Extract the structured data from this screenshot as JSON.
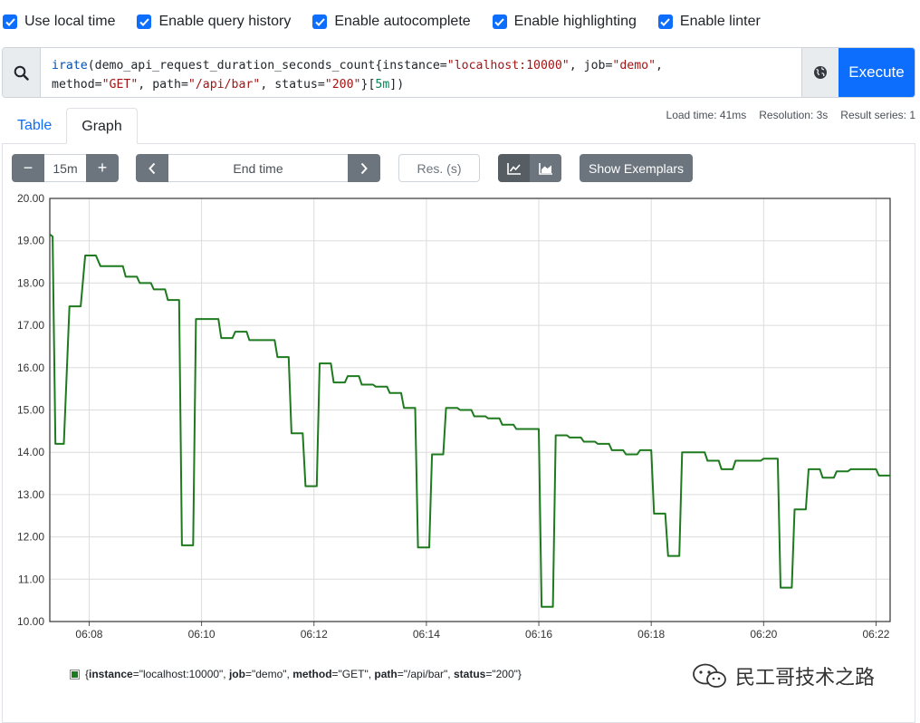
{
  "options": [
    {
      "label": "Use local time",
      "checked": true
    },
    {
      "label": "Enable query history",
      "checked": true
    },
    {
      "label": "Enable autocomplete",
      "checked": true
    },
    {
      "label": "Enable highlighting",
      "checked": true
    },
    {
      "label": "Enable linter",
      "checked": true
    }
  ],
  "query": {
    "fn": "irate",
    "metric": "demo_api_request_duration_seconds_count",
    "labels": [
      {
        "name": "instance",
        "value": "\"localhost:10000\""
      },
      {
        "name": "job",
        "value": "\"demo\""
      },
      {
        "name": "method",
        "value": "\"GET\""
      },
      {
        "name": "path",
        "value": "\"/api/bar\""
      },
      {
        "name": "status",
        "value": "\"200\""
      }
    ],
    "range": "5m"
  },
  "execute_label": "Execute",
  "tabs": {
    "table": "Table",
    "graph": "Graph"
  },
  "stats": {
    "load_time": "Load time: 41ms",
    "resolution": "Resolution: 3s",
    "result_series": "Result series: 1"
  },
  "controls": {
    "minus": "−",
    "range": "15m",
    "plus": "+",
    "end_time_placeholder": "End time",
    "res_placeholder": "Res. (s)",
    "show_exemplars": "Show Exemplars"
  },
  "legend": {
    "parts": [
      {
        "text": "{",
        "bold": false
      },
      {
        "text": "instance",
        "bold": true
      },
      {
        "text": "=\"localhost:10000\", ",
        "bold": false
      },
      {
        "text": "job",
        "bold": true
      },
      {
        "text": "=\"demo\", ",
        "bold": false
      },
      {
        "text": "method",
        "bold": true
      },
      {
        "text": "=\"GET\", ",
        "bold": false
      },
      {
        "text": "path",
        "bold": true
      },
      {
        "text": "=\"/api/bar\", ",
        "bold": false
      },
      {
        "text": "status",
        "bold": true
      },
      {
        "text": "=\"200\"}",
        "bold": false
      }
    ]
  },
  "watermark": "民工哥技术之路",
  "colors": {
    "series": "#1e7a1e",
    "accent": "#0d6efd",
    "secondary": "#6c757d"
  },
  "chart_data": {
    "type": "line",
    "ylim": [
      10,
      20
    ],
    "yticks": [
      "10.00",
      "11.00",
      "12.00",
      "13.00",
      "14.00",
      "15.00",
      "16.00",
      "17.00",
      "18.00",
      "19.00",
      "20.00"
    ],
    "xlim_min": [
      7.3,
      22.25
    ],
    "xticks": [
      {
        "label": "06:08",
        "min": 8
      },
      {
        "label": "06:10",
        "min": 10
      },
      {
        "label": "06:12",
        "min": 12
      },
      {
        "label": "06:14",
        "min": 14
      },
      {
        "label": "06:16",
        "min": 16
      },
      {
        "label": "06:18",
        "min": 18
      },
      {
        "label": "06:20",
        "min": 20
      },
      {
        "label": "06:22",
        "min": 22
      }
    ],
    "series": [
      {
        "values": [
          [
            7.3,
            19.15
          ],
          [
            7.35,
            19.1
          ],
          [
            7.4,
            14.2
          ],
          [
            7.55,
            14.2
          ],
          [
            7.65,
            17.45
          ],
          [
            7.85,
            17.45
          ],
          [
            7.93,
            18.65
          ],
          [
            8.12,
            18.65
          ],
          [
            8.2,
            18.4
          ],
          [
            8.6,
            18.4
          ],
          [
            8.65,
            18.15
          ],
          [
            8.85,
            18.15
          ],
          [
            8.9,
            18.0
          ],
          [
            9.1,
            18.0
          ],
          [
            9.15,
            17.85
          ],
          [
            9.35,
            17.85
          ],
          [
            9.4,
            17.6
          ],
          [
            9.6,
            17.6
          ],
          [
            9.65,
            11.8
          ],
          [
            9.85,
            11.8
          ],
          [
            9.9,
            17.15
          ],
          [
            10.3,
            17.15
          ],
          [
            10.35,
            16.7
          ],
          [
            10.55,
            16.7
          ],
          [
            10.6,
            16.85
          ],
          [
            10.8,
            16.85
          ],
          [
            10.85,
            16.65
          ],
          [
            11.3,
            16.65
          ],
          [
            11.35,
            16.25
          ],
          [
            11.55,
            16.25
          ],
          [
            11.6,
            14.45
          ],
          [
            11.8,
            14.45
          ],
          [
            11.85,
            13.2
          ],
          [
            12.05,
            13.2
          ],
          [
            12.1,
            16.1
          ],
          [
            12.3,
            16.1
          ],
          [
            12.35,
            15.65
          ],
          [
            12.55,
            15.65
          ],
          [
            12.6,
            15.8
          ],
          [
            12.8,
            15.8
          ],
          [
            12.85,
            15.6
          ],
          [
            13.05,
            15.6
          ],
          [
            13.1,
            15.55
          ],
          [
            13.3,
            15.55
          ],
          [
            13.35,
            15.4
          ],
          [
            13.55,
            15.4
          ],
          [
            13.6,
            15.05
          ],
          [
            13.8,
            15.05
          ],
          [
            13.85,
            11.75
          ],
          [
            14.05,
            11.75
          ],
          [
            14.1,
            13.95
          ],
          [
            14.3,
            13.95
          ],
          [
            14.35,
            15.05
          ],
          [
            14.55,
            15.05
          ],
          [
            14.6,
            15.0
          ],
          [
            14.8,
            15.0
          ],
          [
            14.85,
            14.85
          ],
          [
            15.05,
            14.85
          ],
          [
            15.1,
            14.8
          ],
          [
            15.3,
            14.8
          ],
          [
            15.35,
            14.65
          ],
          [
            15.55,
            14.65
          ],
          [
            15.6,
            14.55
          ],
          [
            16.0,
            14.55
          ],
          [
            16.05,
            10.35
          ],
          [
            16.25,
            10.35
          ],
          [
            16.3,
            14.4
          ],
          [
            16.5,
            14.4
          ],
          [
            16.55,
            14.35
          ],
          [
            16.75,
            14.35
          ],
          [
            16.8,
            14.25
          ],
          [
            17.0,
            14.25
          ],
          [
            17.05,
            14.2
          ],
          [
            17.25,
            14.2
          ],
          [
            17.3,
            14.05
          ],
          [
            17.5,
            14.05
          ],
          [
            17.55,
            13.95
          ],
          [
            17.75,
            13.95
          ],
          [
            17.8,
            14.05
          ],
          [
            18.0,
            14.05
          ],
          [
            18.05,
            12.55
          ],
          [
            18.25,
            12.55
          ],
          [
            18.3,
            11.55
          ],
          [
            18.5,
            11.55
          ],
          [
            18.55,
            14.0
          ],
          [
            18.95,
            14.0
          ],
          [
            19.0,
            13.8
          ],
          [
            19.2,
            13.8
          ],
          [
            19.25,
            13.6
          ],
          [
            19.45,
            13.6
          ],
          [
            19.5,
            13.8
          ],
          [
            19.95,
            13.8
          ],
          [
            20.0,
            13.85
          ],
          [
            20.25,
            13.85
          ],
          [
            20.3,
            10.8
          ],
          [
            20.5,
            10.8
          ],
          [
            20.55,
            12.65
          ],
          [
            20.75,
            12.65
          ],
          [
            20.8,
            13.6
          ],
          [
            21.0,
            13.6
          ],
          [
            21.05,
            13.4
          ],
          [
            21.25,
            13.4
          ],
          [
            21.3,
            13.55
          ],
          [
            21.5,
            13.55
          ],
          [
            21.55,
            13.6
          ],
          [
            22.0,
            13.6
          ],
          [
            22.05,
            13.45
          ],
          [
            22.25,
            13.45
          ]
        ]
      }
    ]
  }
}
